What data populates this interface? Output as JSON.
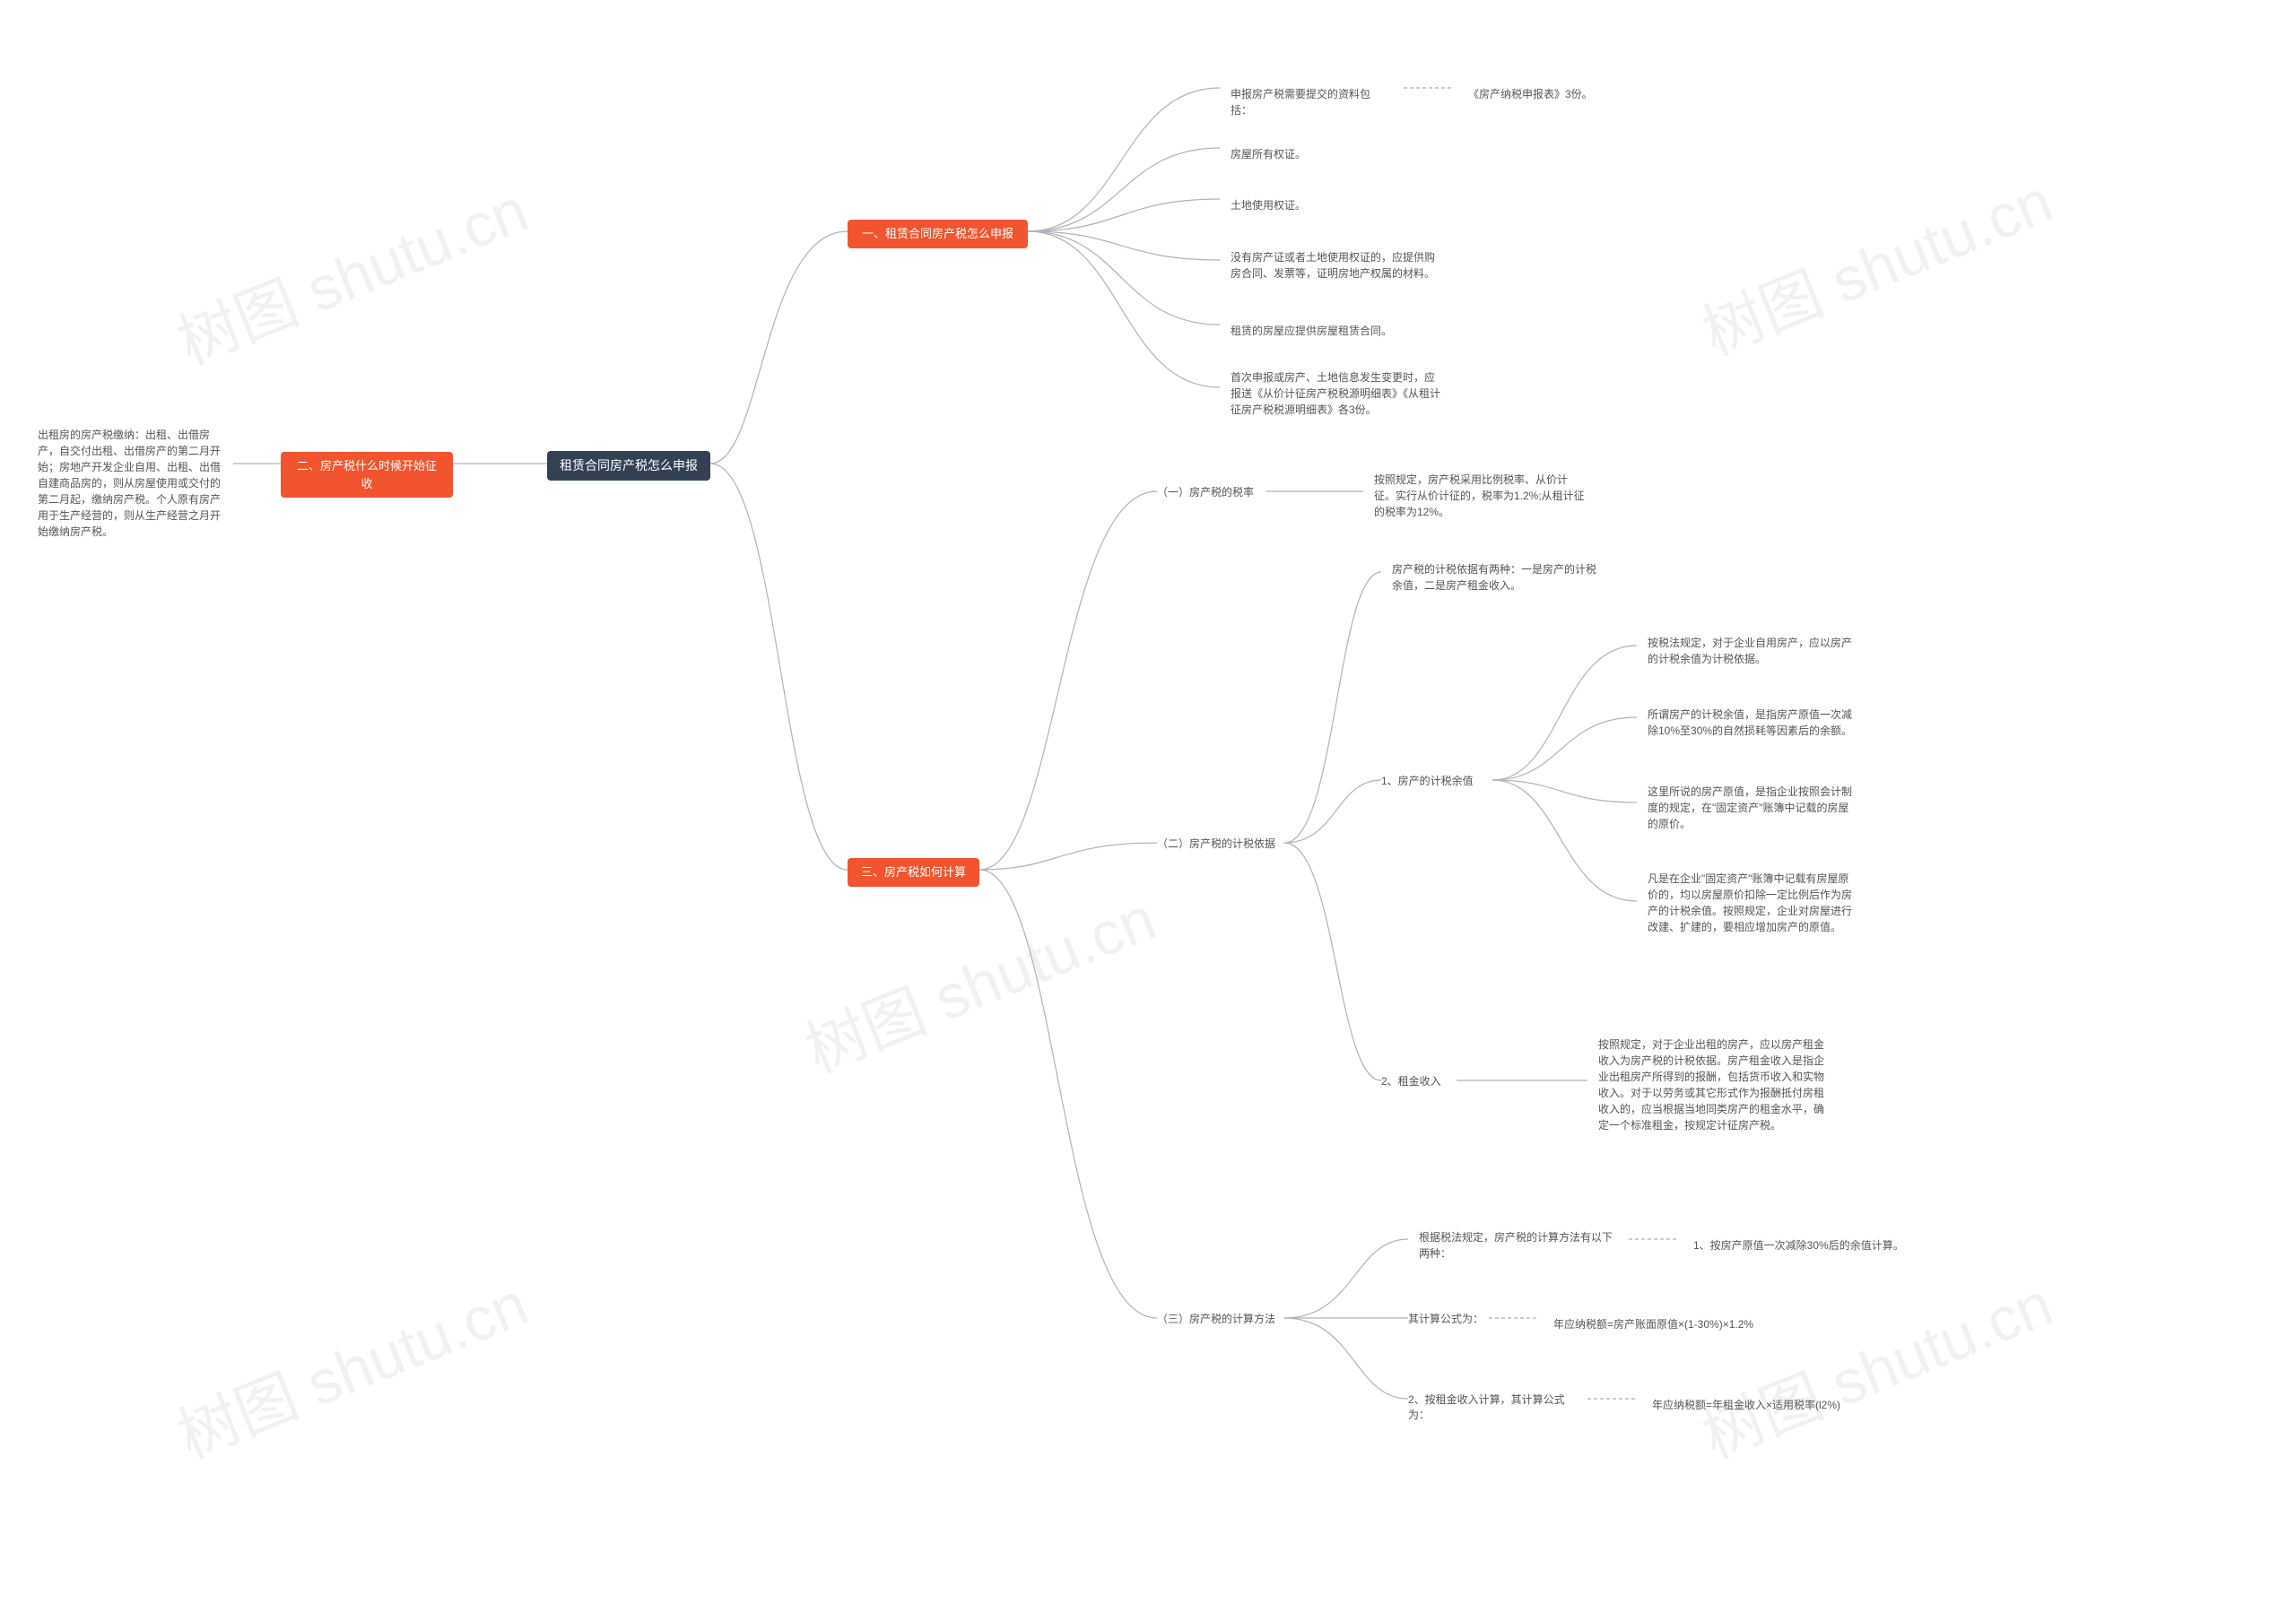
{
  "watermark": "树图 shutu.cn",
  "root": {
    "title": "租赁合同房产税怎么申报"
  },
  "sections": {
    "s1": {
      "title": "一、租赁合同房产税怎么申报",
      "items": {
        "a1_pre": "申报房产税需要提交的资料包括：",
        "a1_post": "《房产纳税申报表》3份。",
        "a2": "房屋所有权证。",
        "a3": "土地使用权证。",
        "a4": "没有房产证或者土地使用权证的，应提供购房合同、发票等，证明房地产权属的材料。",
        "a5": "租赁的房屋应提供房屋租赁合同。",
        "a6": "首次申报或房产、土地信息发生变更时，应报送《从价计征房产税税源明细表》《从租计征房产税税源明细表》各3份。"
      }
    },
    "s2": {
      "title": "二、房产税什么时候开始征收",
      "text": "出租房的房产税缴纳：出租、出借房产，自交付出租、出借房产的第二月开始；房地产开发企业自用、出租、出借自建商品房的，则从房屋使用或交付的第二月起，缴纳房产税。个人原有房产用于生产经营的，则从生产经营之月开始缴纳房产税。"
    },
    "s3": {
      "title": "三、房产税如何计算",
      "sub1": {
        "title": "（一）房产税的税率",
        "text": "按照规定，房产税采用比例税率、从价计征。实行从价计征的，税率为1.2%;从租计征的税率为12%。"
      },
      "sub2": {
        "title": "（二）房产税的计税依据",
        "intro": "房产税的计税依据有两种：一是房产的计税余值，二是房产租金收入。",
        "g1": {
          "title": "1、房产的计税余值",
          "p1": "按税法规定，对于企业自用房产，应以房产的计税余值为计税依据。",
          "p2": "所谓房产的计税余值，是指房产原值一次减除10%至30%的自然损耗等因素后的余额。",
          "p3": "这里所说的房产原值，是指企业按照会计制度的规定，在\"固定资产\"账簿中记载的房屋的原价。",
          "p4": "凡是在企业\"固定资产\"账簿中记载有房屋原价的，均以房屋原价扣除一定比例后作为房产的计税余值。按照规定，企业对房屋进行改建、扩建的，要相应增加房产的原值。"
        },
        "g2": {
          "title": "2、租金收入",
          "text": "按照规定，对于企业出租的房产，应以房产租金收入为房产税的计税依据。房产租金收入是指企业出租房产所得到的报酬，包括货币收入和实物收入。对于以劳务或其它形式作为报酬抵付房租收入的，应当根据当地同类房产的租金水平，确定一个标准租金，按规定计征房产税。"
        }
      },
      "sub3": {
        "title": "（三）房产税的计算方法",
        "p_intro": "根据税法规定，房产税的计算方法有以下两种：",
        "p1": "1、按房产原值一次减除30%后的余值计算。",
        "formula_lead": "其计算公式为：",
        "formula1": "年应纳税额=房产账面原值×(1-30%)×1.2%",
        "p2_lead": "2、按租金收入计算，其计算公式为：",
        "formula2": "年应纳税额=年租金收入×适用税率(l2%)"
      }
    }
  }
}
